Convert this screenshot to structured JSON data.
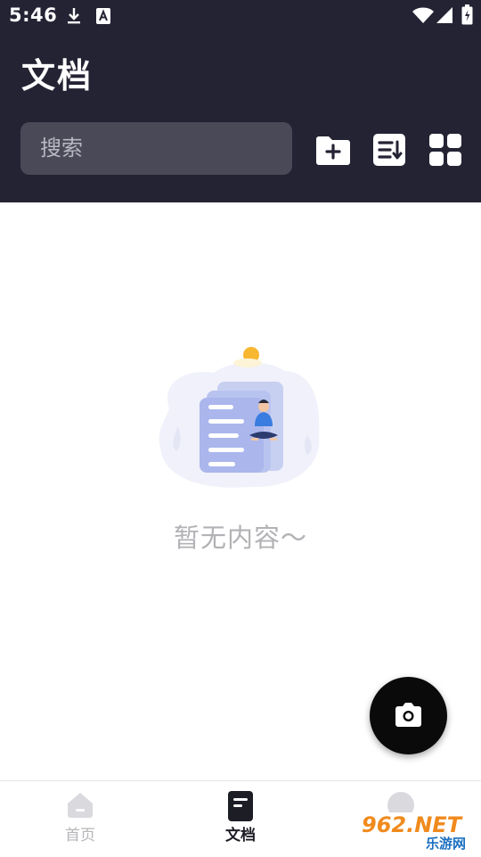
{
  "status_bar": {
    "time": "5:46"
  },
  "header": {
    "title": "文档",
    "search_placeholder": "搜索"
  },
  "toolbar": {
    "icons": [
      "folder-add-icon",
      "sort-icon",
      "grid-view-icon"
    ]
  },
  "empty_state": {
    "text": "暂无内容～"
  },
  "fab": {
    "icon": "camera-icon"
  },
  "bottom_nav": {
    "items": [
      {
        "label": "首页",
        "icon": "home-icon",
        "active": false
      },
      {
        "label": "文档",
        "icon": "document-icon",
        "active": true
      },
      {
        "label": "",
        "icon": "profile-icon",
        "active": false
      }
    ]
  },
  "watermark": {
    "top": "962.NET",
    "bottom": "乐游网"
  },
  "colors": {
    "header_bg": "#242334",
    "search_bg": "#4a4957",
    "active_tab": "#1d1d26",
    "inactive_tab": "#b5b5ba",
    "fab_bg": "#0a0a0a"
  }
}
